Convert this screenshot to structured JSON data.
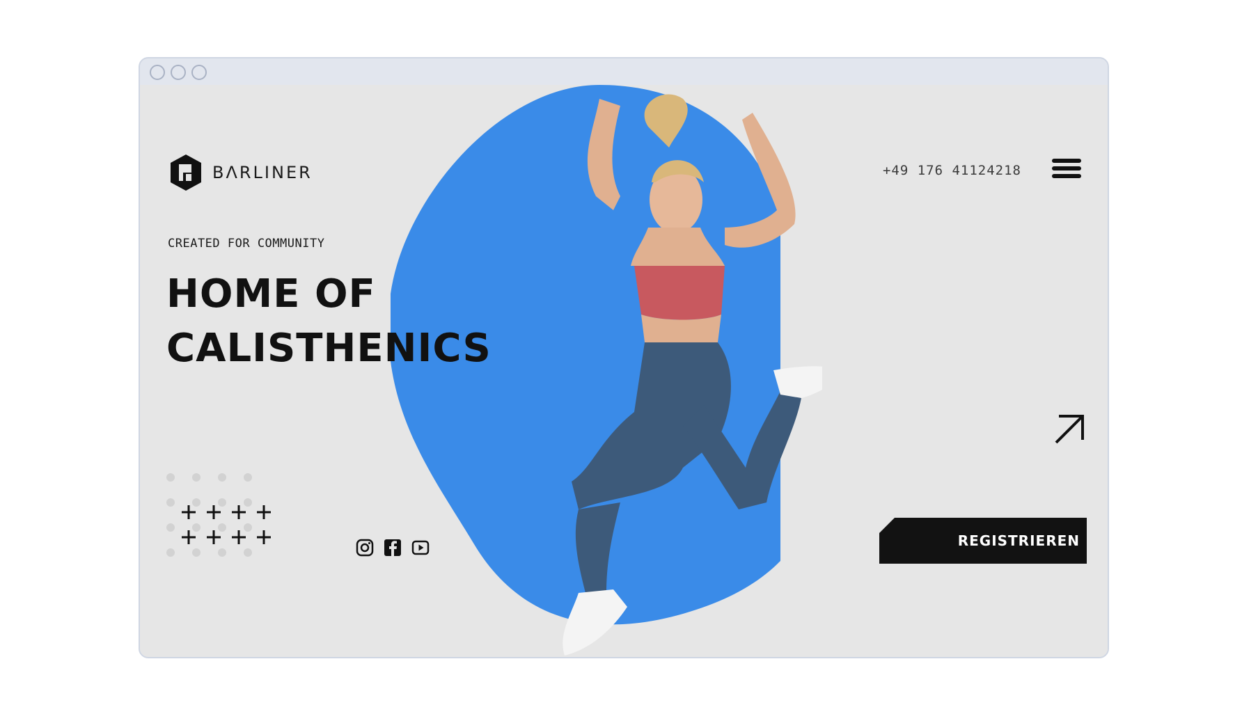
{
  "window": {
    "controls": [
      "close",
      "minimize",
      "maximize"
    ]
  },
  "brand": {
    "name": "BΛRLINER",
    "logo_icon": "barliner-hexagon-logo"
  },
  "header": {
    "phone": "+49 176 41124218",
    "menu_icon": "hamburger-menu-icon"
  },
  "hero": {
    "eyebrow": "CREATED FOR COMMUNITY",
    "headline_line1": "HOME OF",
    "headline_line2": "CALISTHENICS",
    "cta_label": "REGISTRIEREN",
    "arrow_icon": "arrow-up-right-icon"
  },
  "socials": [
    {
      "name": "instagram-icon"
    },
    {
      "name": "facebook-icon"
    },
    {
      "name": "youtube-icon"
    }
  ],
  "colors": {
    "background": "#e6e6e6",
    "blob": "#3a8be8",
    "text": "#111111",
    "button": "#121212",
    "button_text": "#ffffff"
  }
}
